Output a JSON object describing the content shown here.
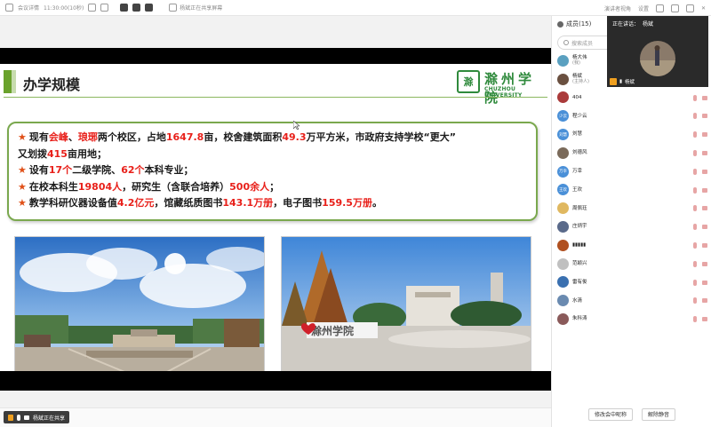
{
  "topbar": {
    "app_name": "会议详情",
    "meeting_time": "11:30:00(10秒)",
    "sharing_status": "杨斌正在共享屏幕",
    "speaker_view": "演讲者视角",
    "settings": "设置"
  },
  "slide": {
    "title": "办学规模",
    "logo_cn": "滁州学院",
    "logo_en": "CHUZHOU UNIVERSITY",
    "lines": [
      [
        {
          "text": "现有",
          "hl": false
        },
        {
          "text": "会峰",
          "hl": true
        },
        {
          "text": "、",
          "hl": false
        },
        {
          "text": "琅琊",
          "hl": true
        },
        {
          "text": "两个校区，占地",
          "hl": false
        },
        {
          "text": "1647.8",
          "hl": true
        },
        {
          "text": "亩，校舍建筑面积",
          "hl": false
        },
        {
          "text": "49.3",
          "hl": true
        },
        {
          "text": "万平方米，市政府支持学校“更大”",
          "hl": false
        }
      ],
      [
        {
          "text": "又划拨",
          "hl": false
        },
        {
          "text": "415",
          "hl": true
        },
        {
          "text": "亩用地；",
          "hl": false
        }
      ],
      [
        {
          "text": "设有",
          "hl": false
        },
        {
          "text": "17个",
          "hl": true
        },
        {
          "text": "二级学院、",
          "hl": false
        },
        {
          "text": "62个",
          "hl": true
        },
        {
          "text": "本科专业；",
          "hl": false
        }
      ],
      [
        {
          "text": "在校本科生",
          "hl": false
        },
        {
          "text": "19804人",
          "hl": true
        },
        {
          "text": "，研究生（含联合培养）",
          "hl": false
        },
        {
          "text": "500余人",
          "hl": true
        },
        {
          "text": "；",
          "hl": false
        }
      ],
      [
        {
          "text": "教学科研仪器设备值",
          "hl": false
        },
        {
          "text": "4.2亿元",
          "hl": true
        },
        {
          "text": "，馆藏纸质图书",
          "hl": false
        },
        {
          "text": "143.1万册",
          "hl": true
        },
        {
          "text": "，电子图书",
          "hl": false
        },
        {
          "text": "159.5万册",
          "hl": true
        },
        {
          "text": "。",
          "hl": false
        }
      ]
    ],
    "bullet_starts": [
      0,
      2,
      3,
      4
    ],
    "photo2_sign": "滁州学院"
  },
  "statusbar": {
    "share_label": "杨斌正在共享"
  },
  "panel": {
    "header": "成员(15)",
    "search_placeholder": "搜索成员",
    "members": [
      {
        "name": "杨大伟",
        "role": "(我)",
        "avatar": "",
        "color": "#5aa0c0",
        "mic": false
      },
      {
        "name": "杨斌",
        "role": "(主持人)",
        "avatar": "",
        "color": "#6a5040",
        "mic": false
      },
      {
        "name": "404",
        "role": "",
        "avatar": "",
        "color": "#aa3a3a",
        "mic": true
      },
      {
        "name": "程少云",
        "role": "",
        "avatar": "少云",
        "color": "#4a90d8",
        "mic": true
      },
      {
        "name": "刘慧",
        "role": "",
        "avatar": "刘慧",
        "color": "#4a90d8",
        "mic": true
      },
      {
        "name": "刘德风",
        "role": "",
        "avatar": "",
        "color": "#7a6a5a",
        "mic": true
      },
      {
        "name": "万幸",
        "role": "",
        "avatar": "万幸",
        "color": "#4a90d8",
        "mic": true
      },
      {
        "name": "王欢",
        "role": "",
        "avatar": "王欢",
        "color": "#4a90d8",
        "mic": true
      },
      {
        "name": "周佩珏",
        "role": "",
        "avatar": "",
        "color": "#e0b860",
        "mic": true
      },
      {
        "name": "庄炳宇",
        "role": "",
        "avatar": "",
        "color": "#5a6a8a",
        "mic": true
      },
      {
        "name": "▮▮▮▮▮",
        "role": "",
        "avatar": "",
        "color": "#b05020",
        "mic": true
      },
      {
        "name": "范颖兴",
        "role": "",
        "avatar": "",
        "color": "#c0c0c0",
        "mic": true
      },
      {
        "name": "雷有俊",
        "role": "",
        "avatar": "",
        "color": "#3a70b0",
        "mic": true
      },
      {
        "name": "水清",
        "role": "",
        "avatar": "",
        "color": "#6a8ab0",
        "mic": true
      },
      {
        "name": "朱科涛",
        "role": "",
        "avatar": "",
        "color": "#8a5a5a",
        "mic": true
      }
    ],
    "footer_buttons": [
      "修改会中昵称",
      "解除静音"
    ]
  },
  "video": {
    "label": "正在讲话：",
    "speaker": "杨斌",
    "footer_name": "杨斌"
  },
  "colors": {
    "accent_green": "#6aa22c",
    "highlight_red": "#e8201a",
    "star_orange": "#e05018",
    "logo_green": "#2f8a3c"
  }
}
